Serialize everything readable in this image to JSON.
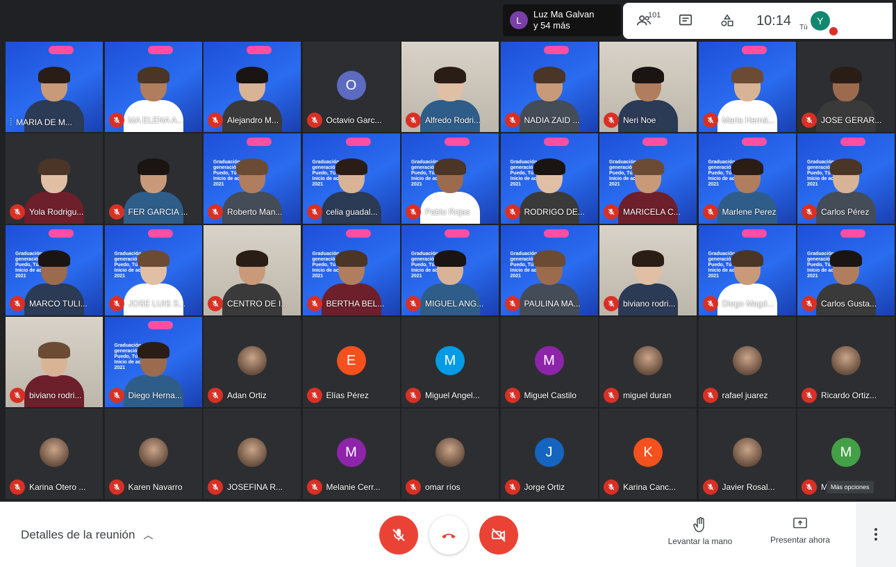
{
  "top": {
    "speaker_initial": "L",
    "speaker_line1": "Luz Ma Galvan",
    "speaker_line2": "y 54 más",
    "participants_count": "101",
    "time": "10:14",
    "self_label": "Tú",
    "self_initial": "Y"
  },
  "participants": [
    {
      "name": "MARIA DE M...",
      "style": "blue",
      "speaking": true
    },
    {
      "name": "MA ELENA A...",
      "style": "blue"
    },
    {
      "name": "Alejandro M...",
      "style": "blue"
    },
    {
      "name": "Octavio Garc...",
      "style": "dark",
      "initial": "O",
      "color": "#5c6bc0"
    },
    {
      "name": "Alfredo Rodri...",
      "style": "room"
    },
    {
      "name": "NADIA ZAID ...",
      "style": "blue"
    },
    {
      "name": "Neri Noe",
      "style": "room"
    },
    {
      "name": "Maria Herná...",
      "style": "blue"
    },
    {
      "name": "JOSE GERAR...",
      "style": "dark"
    },
    {
      "name": "Yola Rodrigu...",
      "style": "dark"
    },
    {
      "name": "FER GARCIA ...",
      "style": "dark"
    },
    {
      "name": "Roberto Man...",
      "style": "blue"
    },
    {
      "name": "celia guadal...",
      "style": "blue"
    },
    {
      "name": "Pablo Rojas",
      "style": "blue"
    },
    {
      "name": "RODRIGO DE...",
      "style": "blue"
    },
    {
      "name": "MARICELA C...",
      "style": "blue"
    },
    {
      "name": "Marlene Perez",
      "style": "blue"
    },
    {
      "name": "Carlos Pérez",
      "style": "blue"
    },
    {
      "name": "MARCO TULI...",
      "style": "blue"
    },
    {
      "name": "JOSE LUIS S...",
      "style": "blue"
    },
    {
      "name": "CENTRO DE I...",
      "style": "room"
    },
    {
      "name": "BERTHA BEL...",
      "style": "blue"
    },
    {
      "name": "MIGUEL ANG...",
      "style": "blue"
    },
    {
      "name": "PAULINA MA...",
      "style": "blue"
    },
    {
      "name": "biviano rodri...",
      "style": "room"
    },
    {
      "name": "Diego Magd...",
      "style": "blue"
    },
    {
      "name": "Carlos Gusta...",
      "style": "blue"
    },
    {
      "name": "biviano rodri...",
      "style": "room"
    },
    {
      "name": "Diego Herna...",
      "style": "blue"
    },
    {
      "name": "Adan Ortiz",
      "style": "dark",
      "photo": true
    },
    {
      "name": "Elías Pérez",
      "style": "dark",
      "initial": "E",
      "color": "#f4511e"
    },
    {
      "name": "Miguel Angel...",
      "style": "dark",
      "initial": "M",
      "color": "#039be5"
    },
    {
      "name": "Miguel Castilo",
      "style": "dark",
      "initial": "M",
      "color": "#8e24aa"
    },
    {
      "name": "miguel duran",
      "style": "dark",
      "photo": true
    },
    {
      "name": "rafael juarez",
      "style": "dark",
      "photo": true
    },
    {
      "name": "Ricardo Ortiz...",
      "style": "dark",
      "photo": true
    },
    {
      "name": "Karina Otero ...",
      "style": "dark",
      "photo": true
    },
    {
      "name": "Karen Navarro",
      "style": "dark",
      "photo": true
    },
    {
      "name": "JOSEFINA R...",
      "style": "dark",
      "photo": true
    },
    {
      "name": "Melanie Cerr...",
      "style": "dark",
      "initial": "M",
      "color": "#8e24aa"
    },
    {
      "name": "omar ríos",
      "style": "dark",
      "photo": true
    },
    {
      "name": "Jorge Ortiz",
      "style": "dark",
      "initial": "J",
      "color": "#1565c0"
    },
    {
      "name": "Karina Canc...",
      "style": "dark",
      "initial": "K",
      "color": "#f4511e"
    },
    {
      "name": "Javier Rosal...",
      "style": "dark",
      "photo": true
    },
    {
      "name": "Mariela Jim...",
      "style": "dark",
      "initial": "M",
      "color": "#43a047"
    }
  ],
  "banner_text": "Graduación generación 2020 Yo Puedo, Tú Puedes e Inicio de actividades 2021",
  "tooltip": "Más opciones",
  "bottom": {
    "details": "Detalles de la reunión",
    "raise_hand": "Levantar la mano",
    "present": "Presentar ahora"
  },
  "icons": {
    "mic_muted": "mic-off-icon",
    "hangup": "phone-hangup-icon",
    "cam_off": "videocam-off-icon",
    "people": "people-icon",
    "chat": "chat-icon",
    "activities": "shapes-icon",
    "hand": "hand-icon",
    "present": "present-icon",
    "more": "more-vert-icon"
  },
  "colors": {
    "accent_red": "#ea4335",
    "self_avatar": "#12876f"
  }
}
